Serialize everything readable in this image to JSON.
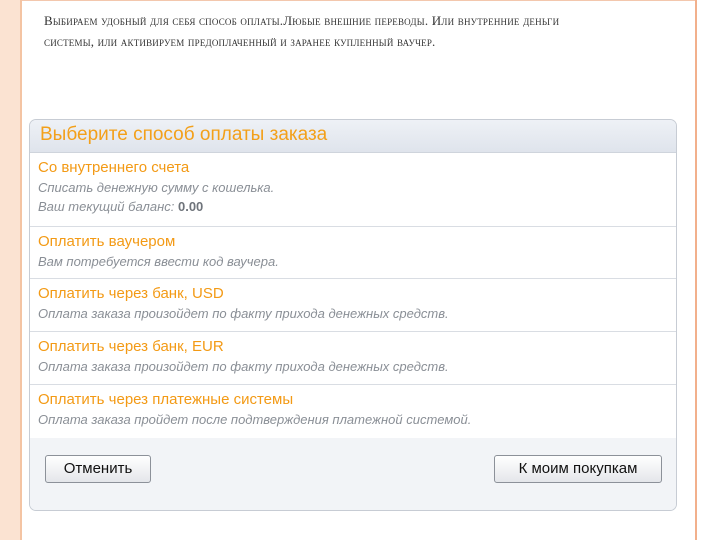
{
  "slide": {
    "text": "Выбираем удобный для себя способ оплаты.Любые внешние переводы. Или внутренние деньги системы, или активируем предоплаченный  и заранее  купленный ваучер."
  },
  "panel": {
    "title": "Выберите способ оплаты заказа",
    "options": [
      {
        "title": "Со внутреннего счета",
        "desc": "Списать денежную сумму с кошелька.",
        "balance_label": "Ваш текущий баланс: ",
        "balance_value": "0.00"
      },
      {
        "title": "Оплатить ваучером",
        "desc": "Вам потребуется ввести код ваучера."
      },
      {
        "title": "Оплатить через банк, USD",
        "desc": "Оплата заказа произойдет по факту прихода денежных средств."
      },
      {
        "title": "Оплатить через банк, EUR",
        "desc": "Оплата заказа произойдет по факту прихода денежных средств."
      },
      {
        "title": "Оплатить через платежные системы",
        "desc": "Оплата заказа пройдет после подтверждения платежной системой."
      }
    ],
    "buttons": {
      "cancel": "Отменить",
      "my_purchases": "К моим покупкам"
    }
  }
}
